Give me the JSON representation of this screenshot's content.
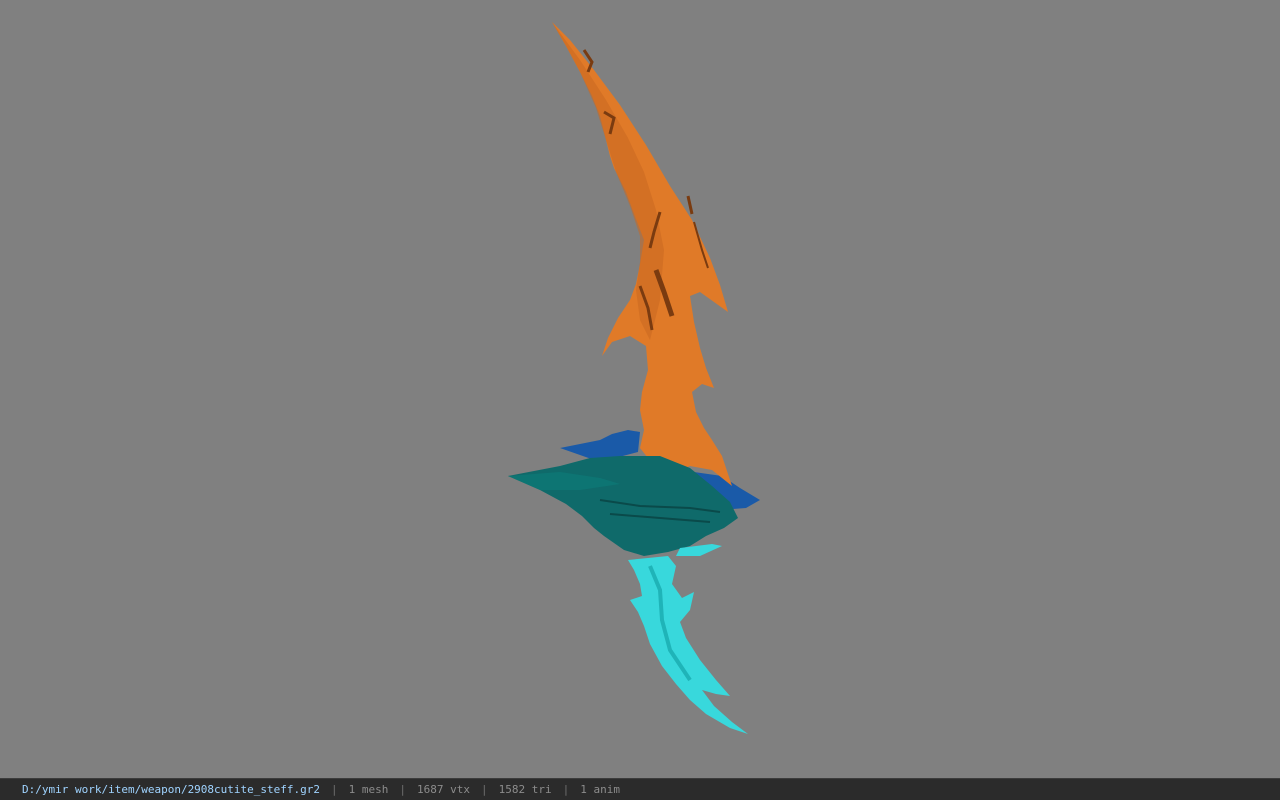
{
  "status_bar": {
    "file_path": "D:/ymir work/item/weapon/2908cutite_steff.gr2",
    "separator": "|",
    "mesh_count": "1 mesh",
    "vertex_count": "1687 vtx",
    "triangle_count": "1582 tri",
    "anim_count": "1 anim"
  },
  "viewport": {
    "background_color": "#808080",
    "model": {
      "blade_color": "#e07a28",
      "guard_color": "#0f6a6a",
      "guard_accent_color": "#1a5aa8",
      "pommel_color": "#38d8dc"
    }
  }
}
